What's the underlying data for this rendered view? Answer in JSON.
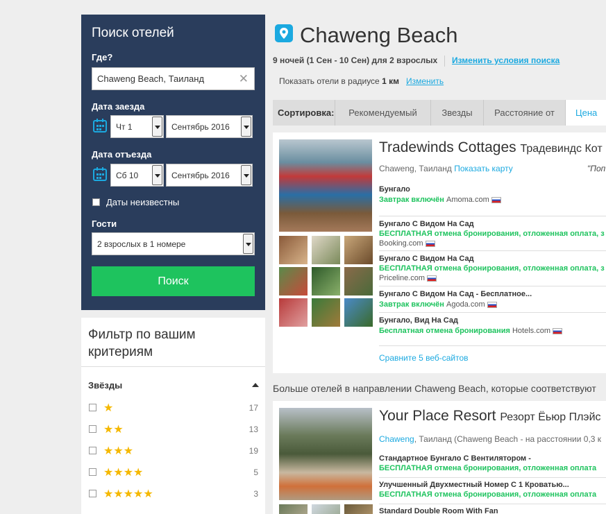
{
  "search": {
    "title": "Поиск отелей",
    "where_label": "Где?",
    "where_value": "Chaweng Beach, Таиланд",
    "checkin_label": "Дата заезда",
    "checkin_day": "Чт 1",
    "checkin_month": "Сентябрь 2016",
    "checkout_label": "Дата отъезда",
    "checkout_day": "Сб 10",
    "checkout_month": "Сентябрь 2016",
    "dates_unknown_label": "Даты неизвестны",
    "guests_label": "Гости",
    "guests_value": "2 взрослых в 1 номере",
    "search_button": "Поиск"
  },
  "filter": {
    "title": "Фильтр по вашим критериям",
    "stars_heading": "Звёзды",
    "stars": [
      {
        "glyphs": "★",
        "count": "17"
      },
      {
        "glyphs": "★★",
        "count": "13"
      },
      {
        "glyphs": "★★★",
        "count": "19"
      },
      {
        "glyphs": "★★★★",
        "count": "5"
      },
      {
        "glyphs": "★★★★★",
        "count": "3"
      }
    ]
  },
  "header": {
    "destination": "Chaweng Beach",
    "stay_info": "9 ночей (1 Сен - 10 Сен) для 2 взрослых",
    "change_search": "Изменить условия поиска",
    "radius_prefix": "Показать отели в радиусе",
    "radius_value": "1 км",
    "radius_change": "Изменить"
  },
  "sort": {
    "label": "Сортировка:",
    "tabs": [
      "Рекомендуемый",
      "Звезды",
      "Расстояние от",
      "Цена (з"
    ]
  },
  "hotel1": {
    "name": "Tradewinds Cottages",
    "name_ru": "Традевиндс Кот",
    "location": "Chaweng, Таиланд",
    "show_map": "Показать карту",
    "quote": "\"Поп",
    "offers": [
      {
        "room": "Бунгало",
        "deal": "Завтрак включён",
        "site": "Amoma.com"
      },
      {
        "room": "Бунгало С Видом На Сад",
        "deal": "БЕСПЛАТНАЯ отмена бронирования, отложенная оплата, з",
        "site": "Booking.com"
      },
      {
        "room": "Бунгало С Видом На Сад",
        "deal": "БЕСПЛАТНАЯ отмена бронирования, отложенная оплата, з",
        "site": "Priceline.com"
      },
      {
        "room": "Бунгало С Видом На Сад - Бесплатное...",
        "deal": "Завтрак включён",
        "site": "Agoda.com"
      },
      {
        "room": "Бунгало, Вид На Сад",
        "deal": "Бесплатная отмена бронирования",
        "site": "Hotels.com"
      }
    ],
    "compare": "Сравните 5 веб-сайтов"
  },
  "more_hotels": "Больше отелей в направлении Chaweng Beach, которые соответствуют",
  "hotel2": {
    "name": "Your Place Resort",
    "name_ru": "Резорт Ёьюр Плэйс",
    "location_link": "Chaweng",
    "location_rest": ", Таиланд (Chaweng Beach - на расстоянии 0,3 к",
    "offers": [
      {
        "room": "Стандартное Бунгало С Вентилятором -",
        "deal": "БЕСПЛАТНАЯ отмена бронирования, отложенная оплата"
      },
      {
        "room": "Улучшенный Двухместный Номер С 1 Кроватью...",
        "deal": "БЕСПЛАТНАЯ отмена бронирования, отложенная оплата"
      },
      {
        "room": "Standard Double Room With Fan",
        "deal": ""
      }
    ]
  },
  "colors": {
    "panel_navy": "#2a3d5c",
    "accent_blue": "#1ba9e0",
    "accent_green": "#1ec35e",
    "star_gold": "#f5b800"
  }
}
